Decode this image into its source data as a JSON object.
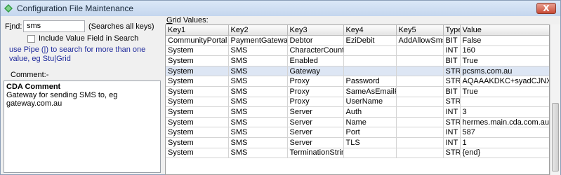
{
  "window": {
    "title": "Configuration File Maintenance",
    "close_label": "X"
  },
  "find": {
    "label_prefix": "F",
    "label_underlined": "i",
    "label_suffix": "nd:",
    "value": "sms",
    "hint": "(Searches all keys)"
  },
  "include_value": {
    "label": "Include Value Field  in Search",
    "checked": false
  },
  "help_text": "use Pipe (|) to search for more than one value, eg Stu|Grid",
  "comment": {
    "label": "Comment:-",
    "title": "CDA Comment",
    "body": "Gateway for sending SMS to, eg gateway.com.au"
  },
  "grid": {
    "label_underlined": "G",
    "label_rest": "rid Values:",
    "columns": [
      "Key1",
      "Key2",
      "Key3",
      "Key4",
      "Key5",
      "Type",
      "Value"
    ],
    "selected_row": 3,
    "rows": [
      [
        "CommunityPortal",
        "PaymentGateway",
        "Debtor",
        "EziDebit",
        "AddAllowSms",
        "BIT",
        "False"
      ],
      [
        "System",
        "SMS",
        "CharacterCount",
        "",
        "",
        "INT",
        "160"
      ],
      [
        "System",
        "SMS",
        "Enabled",
        "",
        "",
        "BIT",
        "True"
      ],
      [
        "System",
        "SMS",
        "Gateway",
        "",
        "",
        "STR",
        "pcsms.com.au"
      ],
      [
        "System",
        "SMS",
        "Proxy",
        "Password",
        "",
        "STR",
        "AQAAAKDKC+syadCJNXdiVnE"
      ],
      [
        "System",
        "SMS",
        "Proxy",
        "SameAsEmailFlag",
        "",
        "BIT",
        "True"
      ],
      [
        "System",
        "SMS",
        "Proxy",
        "UserName",
        "",
        "STR",
        ""
      ],
      [
        "System",
        "SMS",
        "Server",
        "Auth",
        "",
        "INT",
        "3"
      ],
      [
        "System",
        "SMS",
        "Server",
        "Name",
        "",
        "STR",
        "hermes.main.cda.com.au"
      ],
      [
        "System",
        "SMS",
        "Server",
        "Port",
        "",
        "INT",
        "587"
      ],
      [
        "System",
        "SMS",
        "Server",
        "TLS",
        "",
        "INT",
        "1"
      ],
      [
        "System",
        "SMS",
        "TerminationString",
        "",
        "",
        "STR",
        "{end}"
      ]
    ]
  }
}
